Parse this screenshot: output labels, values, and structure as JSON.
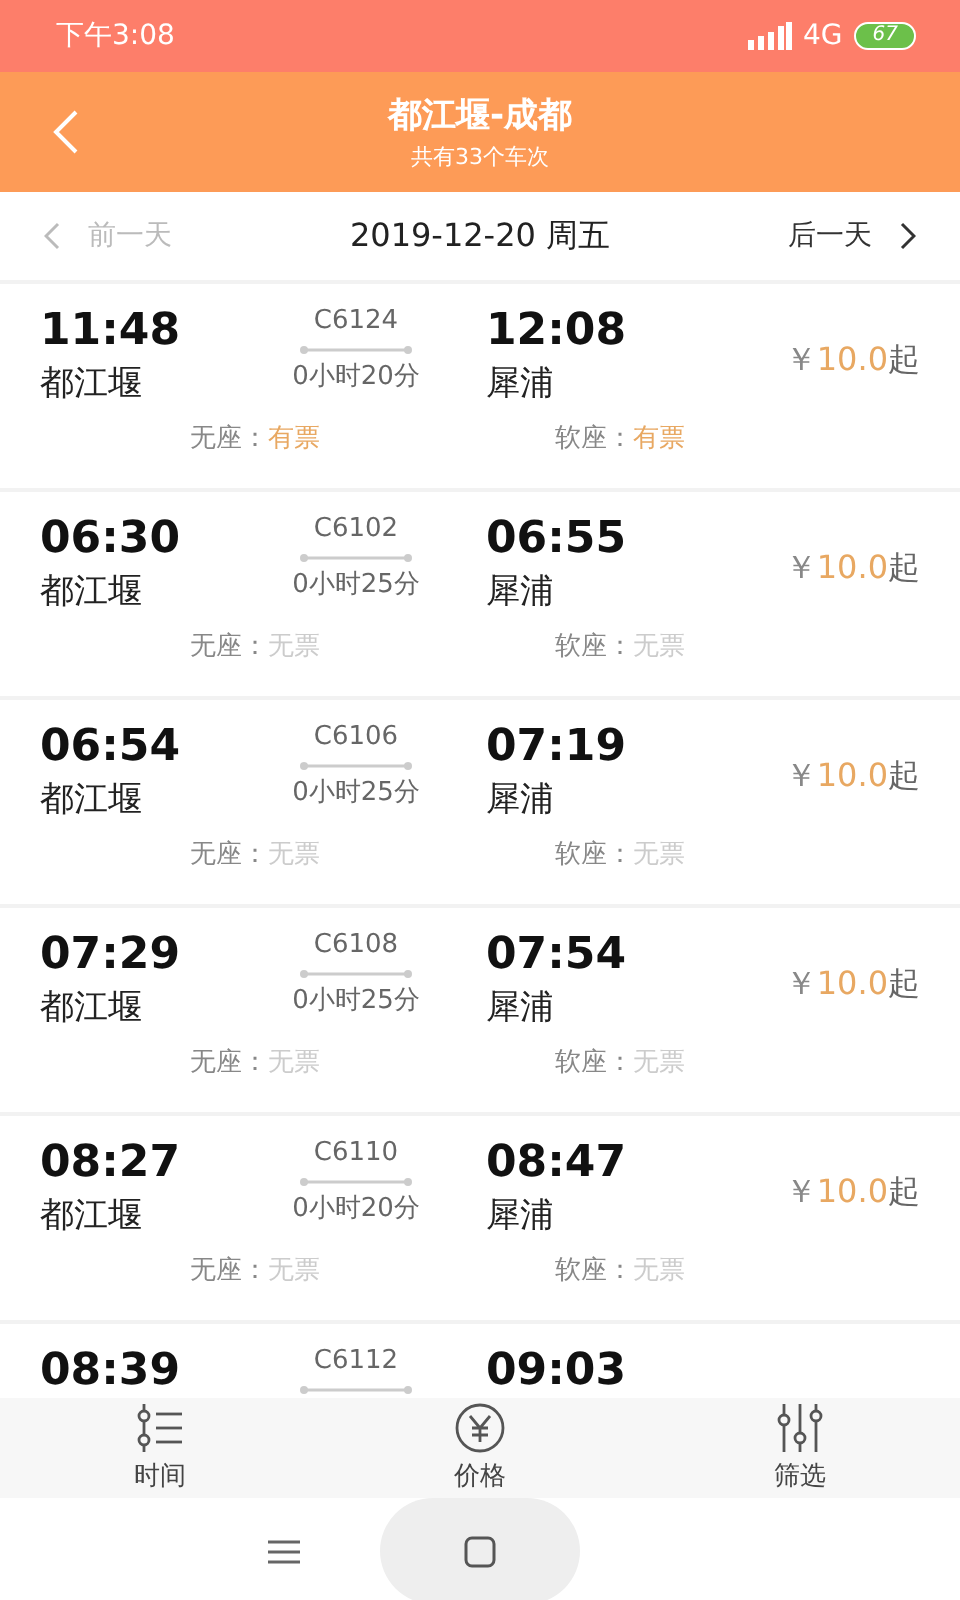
{
  "status_bar": {
    "time": "下午3:08",
    "network": "4G",
    "battery": "67"
  },
  "header": {
    "title": "都江堰-成都",
    "subtitle": "共有33个车次"
  },
  "date_bar": {
    "prev": {
      "label": "前一天",
      "disabled": true
    },
    "date": "2019-12-20 周五",
    "next": {
      "label": "后一天",
      "disabled": false
    }
  },
  "trains": [
    {
      "depart_time": "11:48",
      "depart_station": "都江堰",
      "code": "C6124",
      "duration": "0小时20分",
      "arrive_time": "12:08",
      "arrive_station": "犀浦",
      "price": {
        "currency": "￥",
        "amount": "10.0",
        "suffix": "起"
      },
      "seats": [
        {
          "label": "无座：",
          "status": "有票",
          "available": true
        },
        {
          "label": "软座：",
          "status": "有票",
          "available": true
        }
      ]
    },
    {
      "depart_time": "06:30",
      "depart_station": "都江堰",
      "code": "C6102",
      "duration": "0小时25分",
      "arrive_time": "06:55",
      "arrive_station": "犀浦",
      "price": {
        "currency": "￥",
        "amount": "10.0",
        "suffix": "起"
      },
      "seats": [
        {
          "label": "无座：",
          "status": "无票",
          "available": false
        },
        {
          "label": "软座：",
          "status": "无票",
          "available": false
        }
      ]
    },
    {
      "depart_time": "06:54",
      "depart_station": "都江堰",
      "code": "C6106",
      "duration": "0小时25分",
      "arrive_time": "07:19",
      "arrive_station": "犀浦",
      "price": {
        "currency": "￥",
        "amount": "10.0",
        "suffix": "起"
      },
      "seats": [
        {
          "label": "无座：",
          "status": "无票",
          "available": false
        },
        {
          "label": "软座：",
          "status": "无票",
          "available": false
        }
      ]
    },
    {
      "depart_time": "07:29",
      "depart_station": "都江堰",
      "code": "C6108",
      "duration": "0小时25分",
      "arrive_time": "07:54",
      "arrive_station": "犀浦",
      "price": {
        "currency": "￥",
        "amount": "10.0",
        "suffix": "起"
      },
      "seats": [
        {
          "label": "无座：",
          "status": "无票",
          "available": false
        },
        {
          "label": "软座：",
          "status": "无票",
          "available": false
        }
      ]
    },
    {
      "depart_time": "08:27",
      "depart_station": "都江堰",
      "code": "C6110",
      "duration": "0小时20分",
      "arrive_time": "08:47",
      "arrive_station": "犀浦",
      "price": {
        "currency": "￥",
        "amount": "10.0",
        "suffix": "起"
      },
      "seats": [
        {
          "label": "无座：",
          "status": "无票",
          "available": false
        },
        {
          "label": "软座：",
          "status": "无票",
          "available": false
        }
      ]
    },
    {
      "depart_time": "08:39",
      "code": "C6112",
      "arrive_time": "09:03"
    }
  ],
  "tab_bar": [
    {
      "kind": "time",
      "label": "时间"
    },
    {
      "kind": "price",
      "label": "价格"
    },
    {
      "kind": "filter",
      "label": "筛选"
    }
  ]
}
